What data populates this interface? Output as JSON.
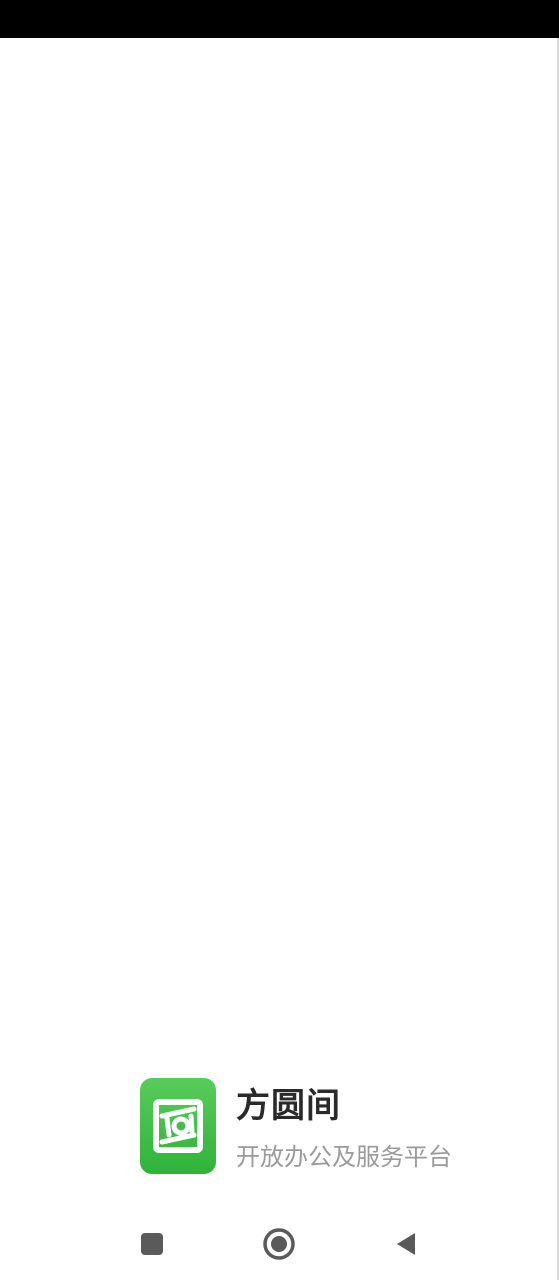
{
  "app": {
    "name": "方圆间",
    "tagline": "开放办公及服务平台"
  },
  "icons": {
    "app_logo": "fangyuanjian-logo-icon",
    "recents": "square-icon",
    "home": "circle-icon",
    "back": "triangle-back-icon"
  },
  "colors": {
    "status_bar": "#000000",
    "background": "#ffffff",
    "logo_green": "#3dbb45",
    "app_name": "#2a2a2a",
    "tagline": "#9a9a9a",
    "nav_icons": "#5a5a5a"
  }
}
